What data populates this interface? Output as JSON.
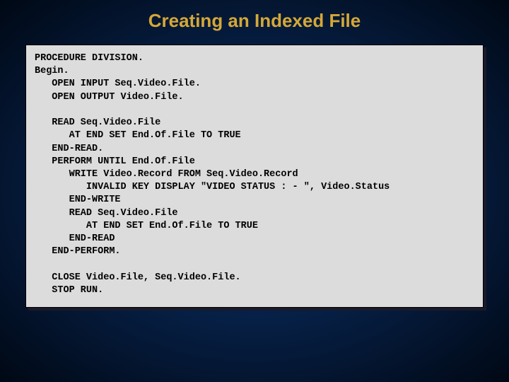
{
  "title": "Creating an Indexed File",
  "code": "PROCEDURE DIVISION.\nBegin.\n   OPEN INPUT Seq.Video.File.\n   OPEN OUTPUT Video.File.\n\n   READ Seq.Video.File\n      AT END SET End.Of.File TO TRUE\n   END-READ.\n   PERFORM UNTIL End.Of.File\n      WRITE Video.Record FROM Seq.Video.Record\n         INVALID KEY DISPLAY \"VIDEO STATUS : - \", Video.Status\n      END-WRITE\n      READ Seq.Video.File\n         AT END SET End.Of.File TO TRUE\n      END-READ\n   END-PERFORM.\n\n   CLOSE Video.File, Seq.Video.File.\n   STOP RUN."
}
